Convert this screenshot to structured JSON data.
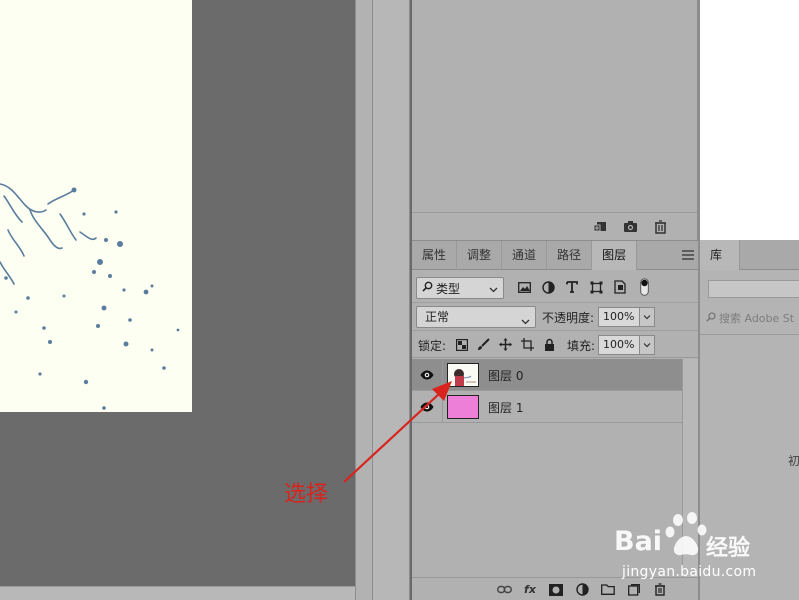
{
  "history_panel": {
    "footer_icons": [
      "new-snapshot-icon",
      "camera-icon",
      "trash-icon"
    ]
  },
  "layers_panel": {
    "tabs": [
      {
        "label": "属性",
        "active": false
      },
      {
        "label": "调整",
        "active": false
      },
      {
        "label": "通道",
        "active": false
      },
      {
        "label": "路径",
        "active": false
      },
      {
        "label": "图层",
        "active": true
      }
    ],
    "filter": {
      "kind_label": "类型",
      "icons": [
        "image-filter-icon",
        "adjustment-filter-icon",
        "type-filter-icon",
        "shape-filter-icon",
        "smart-object-filter-icon",
        "filter-toggle-icon"
      ]
    },
    "blend_mode": "正常",
    "opacity_label": "不透明度:",
    "opacity_value": "100%",
    "lock_label": "锁定:",
    "lock_icons": [
      "lock-transparency-icon",
      "lock-paint-icon",
      "lock-position-icon",
      "lock-artboard-icon",
      "lock-all-icon"
    ],
    "fill_label": "填充:",
    "fill_value": "100%",
    "layers": [
      {
        "name": "图层 0",
        "visible": true,
        "selected": true,
        "thumb": "photo"
      },
      {
        "name": "图层 1",
        "visible": true,
        "selected": false,
        "thumb_color": "#ee7fd8"
      }
    ],
    "footer_icons": [
      "link-icon",
      "fx-icon",
      "mask-icon",
      "adjustment-layer-icon",
      "group-folder-icon",
      "new-layer-icon",
      "delete-layer-icon"
    ],
    "footer_fx_label": "fx"
  },
  "library_panel": {
    "tab_label": "库",
    "search_placeholder": "搜索 Adobe St",
    "init_text": "初"
  },
  "annotation": {
    "label": "选择",
    "color": "#d9231e"
  },
  "watermark": {
    "logo_text": "Bai",
    "logo_text_2": "经验",
    "url": "jingyan.baidu.com"
  },
  "colors": {
    "canvas_bg": "#6b6b6b",
    "panel_bg": "#b1b1b1",
    "document_bg": "#fefff3",
    "selected_row": "#8e8e8e"
  }
}
